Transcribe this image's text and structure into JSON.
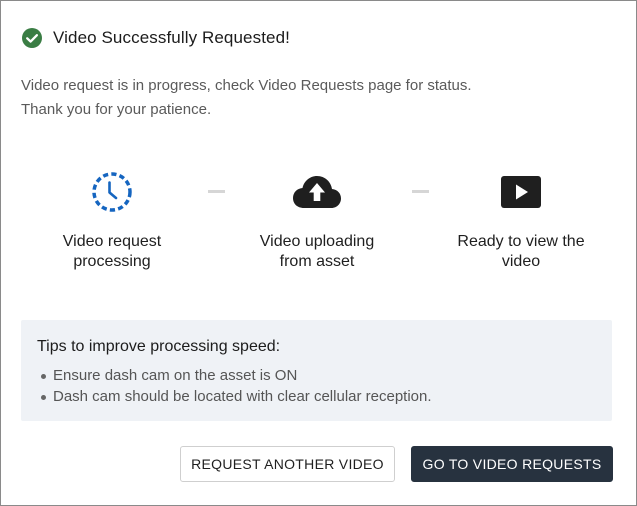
{
  "dialog": {
    "title": "Video Successfully Requested!",
    "description_lines": [
      "Video request is in progress, check Video Requests page for status.",
      "Thank you for your patience."
    ],
    "steps": [
      {
        "icon": "clock-icon",
        "label_lines": [
          "Video request",
          "processing"
        ],
        "color": "#1565c0"
      },
      {
        "icon": "cloud-upload-icon",
        "label_lines": [
          "Video uploading",
          "from asset"
        ],
        "color": "#1f1f1f"
      },
      {
        "icon": "play-video-icon",
        "label_lines": [
          "Ready to view the",
          "video"
        ],
        "color": "#1f1f1f"
      }
    ],
    "tips": {
      "title": "Tips to improve processing speed:",
      "items": [
        "Ensure dash cam on the asset is ON",
        "Dash cam should be located with clear cellular reception."
      ]
    },
    "buttons": {
      "request_another": "REQUEST ANOTHER VIDEO",
      "go_to_requests": "GO TO VIDEO REQUESTS"
    }
  },
  "colors": {
    "success": "#3a7d44",
    "accent_blue": "#1565c0",
    "primary_button": "#27323f",
    "tips_background": "#eff2f6"
  }
}
